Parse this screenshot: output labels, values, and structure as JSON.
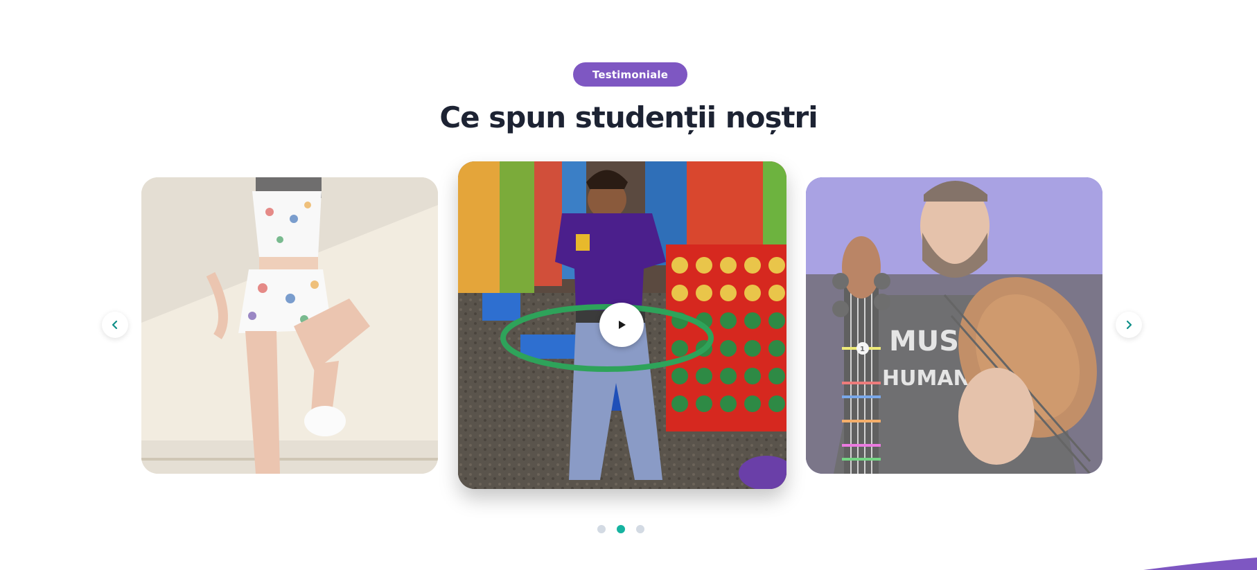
{
  "section": {
    "badge_label": "Testimoniale",
    "title": "Ce spun studenții noștri"
  },
  "carousel": {
    "slides": [
      {
        "id": "dancer",
        "state": "inactive"
      },
      {
        "id": "hula-hoop",
        "state": "active",
        "control": "play-icon"
      },
      {
        "id": "violinist",
        "state": "inactive"
      }
    ],
    "prev_icon": "chevron-left-icon",
    "next_icon": "chevron-right-icon",
    "active_index": 1,
    "dot_count": 3
  },
  "colors": {
    "accent_purple": "#7e57c2",
    "title_color": "#1d2333",
    "arrow_teal": "#0f8f88",
    "dot_active": "#16b3a0",
    "dot_inactive": "#d3dae3"
  }
}
